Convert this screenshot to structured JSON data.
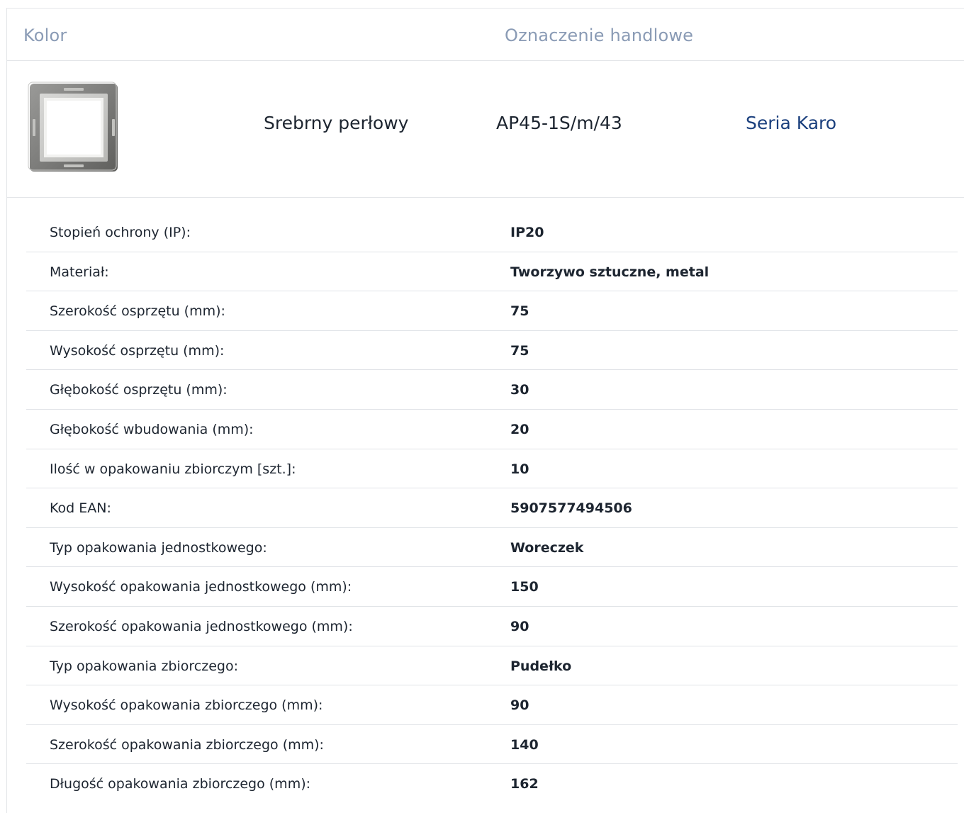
{
  "header": {
    "color_label": "Kolor",
    "trade_designation_label": "Oznaczenie handlowe"
  },
  "product": {
    "image_icon": "socket-frame-icon",
    "color_value": "Srebrny perłowy",
    "trade_designation": "AP45-1S/m/43",
    "series_link": "Seria Karo",
    "link_color": "#1a3f7d"
  },
  "specs": [
    {
      "label": "Stopień ochrony (IP):",
      "value": "IP20"
    },
    {
      "label": "Materiał:",
      "value": "Tworzywo sztuczne, metal"
    },
    {
      "label": "Szerokość osprzętu (mm):",
      "value": "75"
    },
    {
      "label": "Wysokość osprzętu (mm):",
      "value": "75"
    },
    {
      "label": "Głębokość osprzętu (mm):",
      "value": "30"
    },
    {
      "label": "Głębokość wbudowania (mm):",
      "value": "20"
    },
    {
      "label": "Ilość w opakowaniu zbiorczym [szt.]:",
      "value": "10"
    },
    {
      "label": "Kod EAN:",
      "value": "5907577494506"
    },
    {
      "label": "Typ opakowania jednostkowego:",
      "value": "Woreczek"
    },
    {
      "label": "Wysokość opakowania jednostkowego (mm):",
      "value": "150"
    },
    {
      "label": "Szerokość opakowania jednostkowego (mm):",
      "value": "90"
    },
    {
      "label": "Typ opakowania zbiorczego:",
      "value": "Pudełko"
    },
    {
      "label": "Wysokość opakowania zbiorczego (mm):",
      "value": "90"
    },
    {
      "label": "Szerokość opakowania zbiorczego (mm):",
      "value": "140"
    },
    {
      "label": "Długość opakowania zbiorczego (mm):",
      "value": "162"
    }
  ]
}
